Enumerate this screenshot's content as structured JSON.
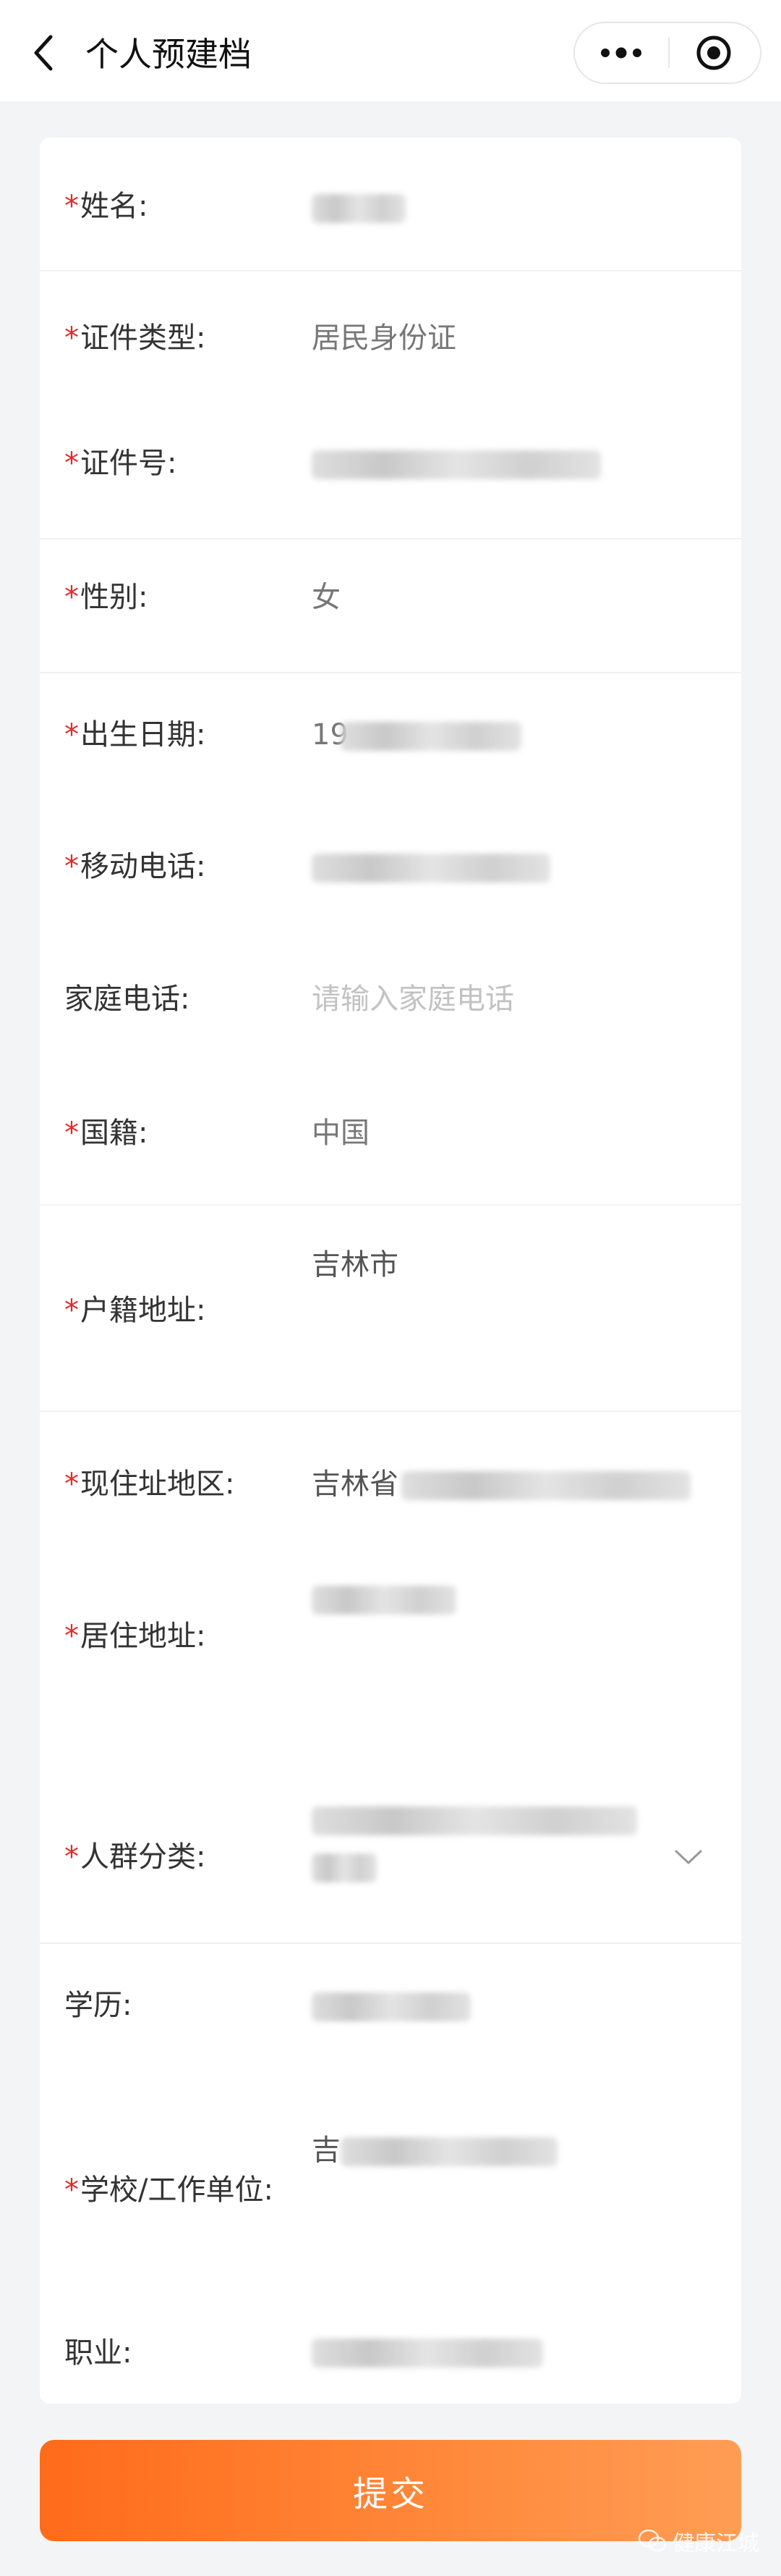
{
  "nav": {
    "title": "个人预建档"
  },
  "fields": {
    "name": {
      "label": "姓名:",
      "required": "*",
      "value": ""
    },
    "id_type": {
      "label": "证件类型:",
      "required": "*",
      "value": "居民身份证"
    },
    "id_number": {
      "label": "证件号:",
      "required": "*",
      "value": ""
    },
    "gender": {
      "label": "性别:",
      "required": "*",
      "value": "女"
    },
    "birth": {
      "label": "出生日期:",
      "required": "*",
      "value": "19"
    },
    "mobile": {
      "label": "移动电话:",
      "required": "*",
      "value": ""
    },
    "home_phone": {
      "label": "家庭电话:",
      "placeholder": "请输入家庭电话"
    },
    "nationality": {
      "label": "国籍:",
      "required": "*",
      "value": "中国"
    },
    "hukou": {
      "label": "户籍地址:",
      "required": "*",
      "value": "吉林市"
    },
    "current_region": {
      "label": "现住址地区:",
      "required": "*",
      "value": "吉林省"
    },
    "residence": {
      "label": "居住地址:",
      "required": "*",
      "value": ""
    },
    "population": {
      "label": "人群分类:",
      "required": "*",
      "value": ""
    },
    "education": {
      "label": "学历:",
      "value": ""
    },
    "workplace": {
      "label": "学校/工作单位:",
      "required": "*",
      "value": "吉"
    },
    "occupation": {
      "label": "职业:",
      "value": ""
    }
  },
  "submit_label": "提交",
  "watermark": "健康江城",
  "icons": {
    "back": "chevron-left-icon",
    "more": "more-dots-icon",
    "close": "target-circle-icon",
    "dropdown": "chevron-down-icon",
    "watermark": "wechat-icon"
  },
  "colors": {
    "required": "#e02b2b",
    "submit_start": "#ff6b1a",
    "submit_end": "#ff9d55"
  }
}
